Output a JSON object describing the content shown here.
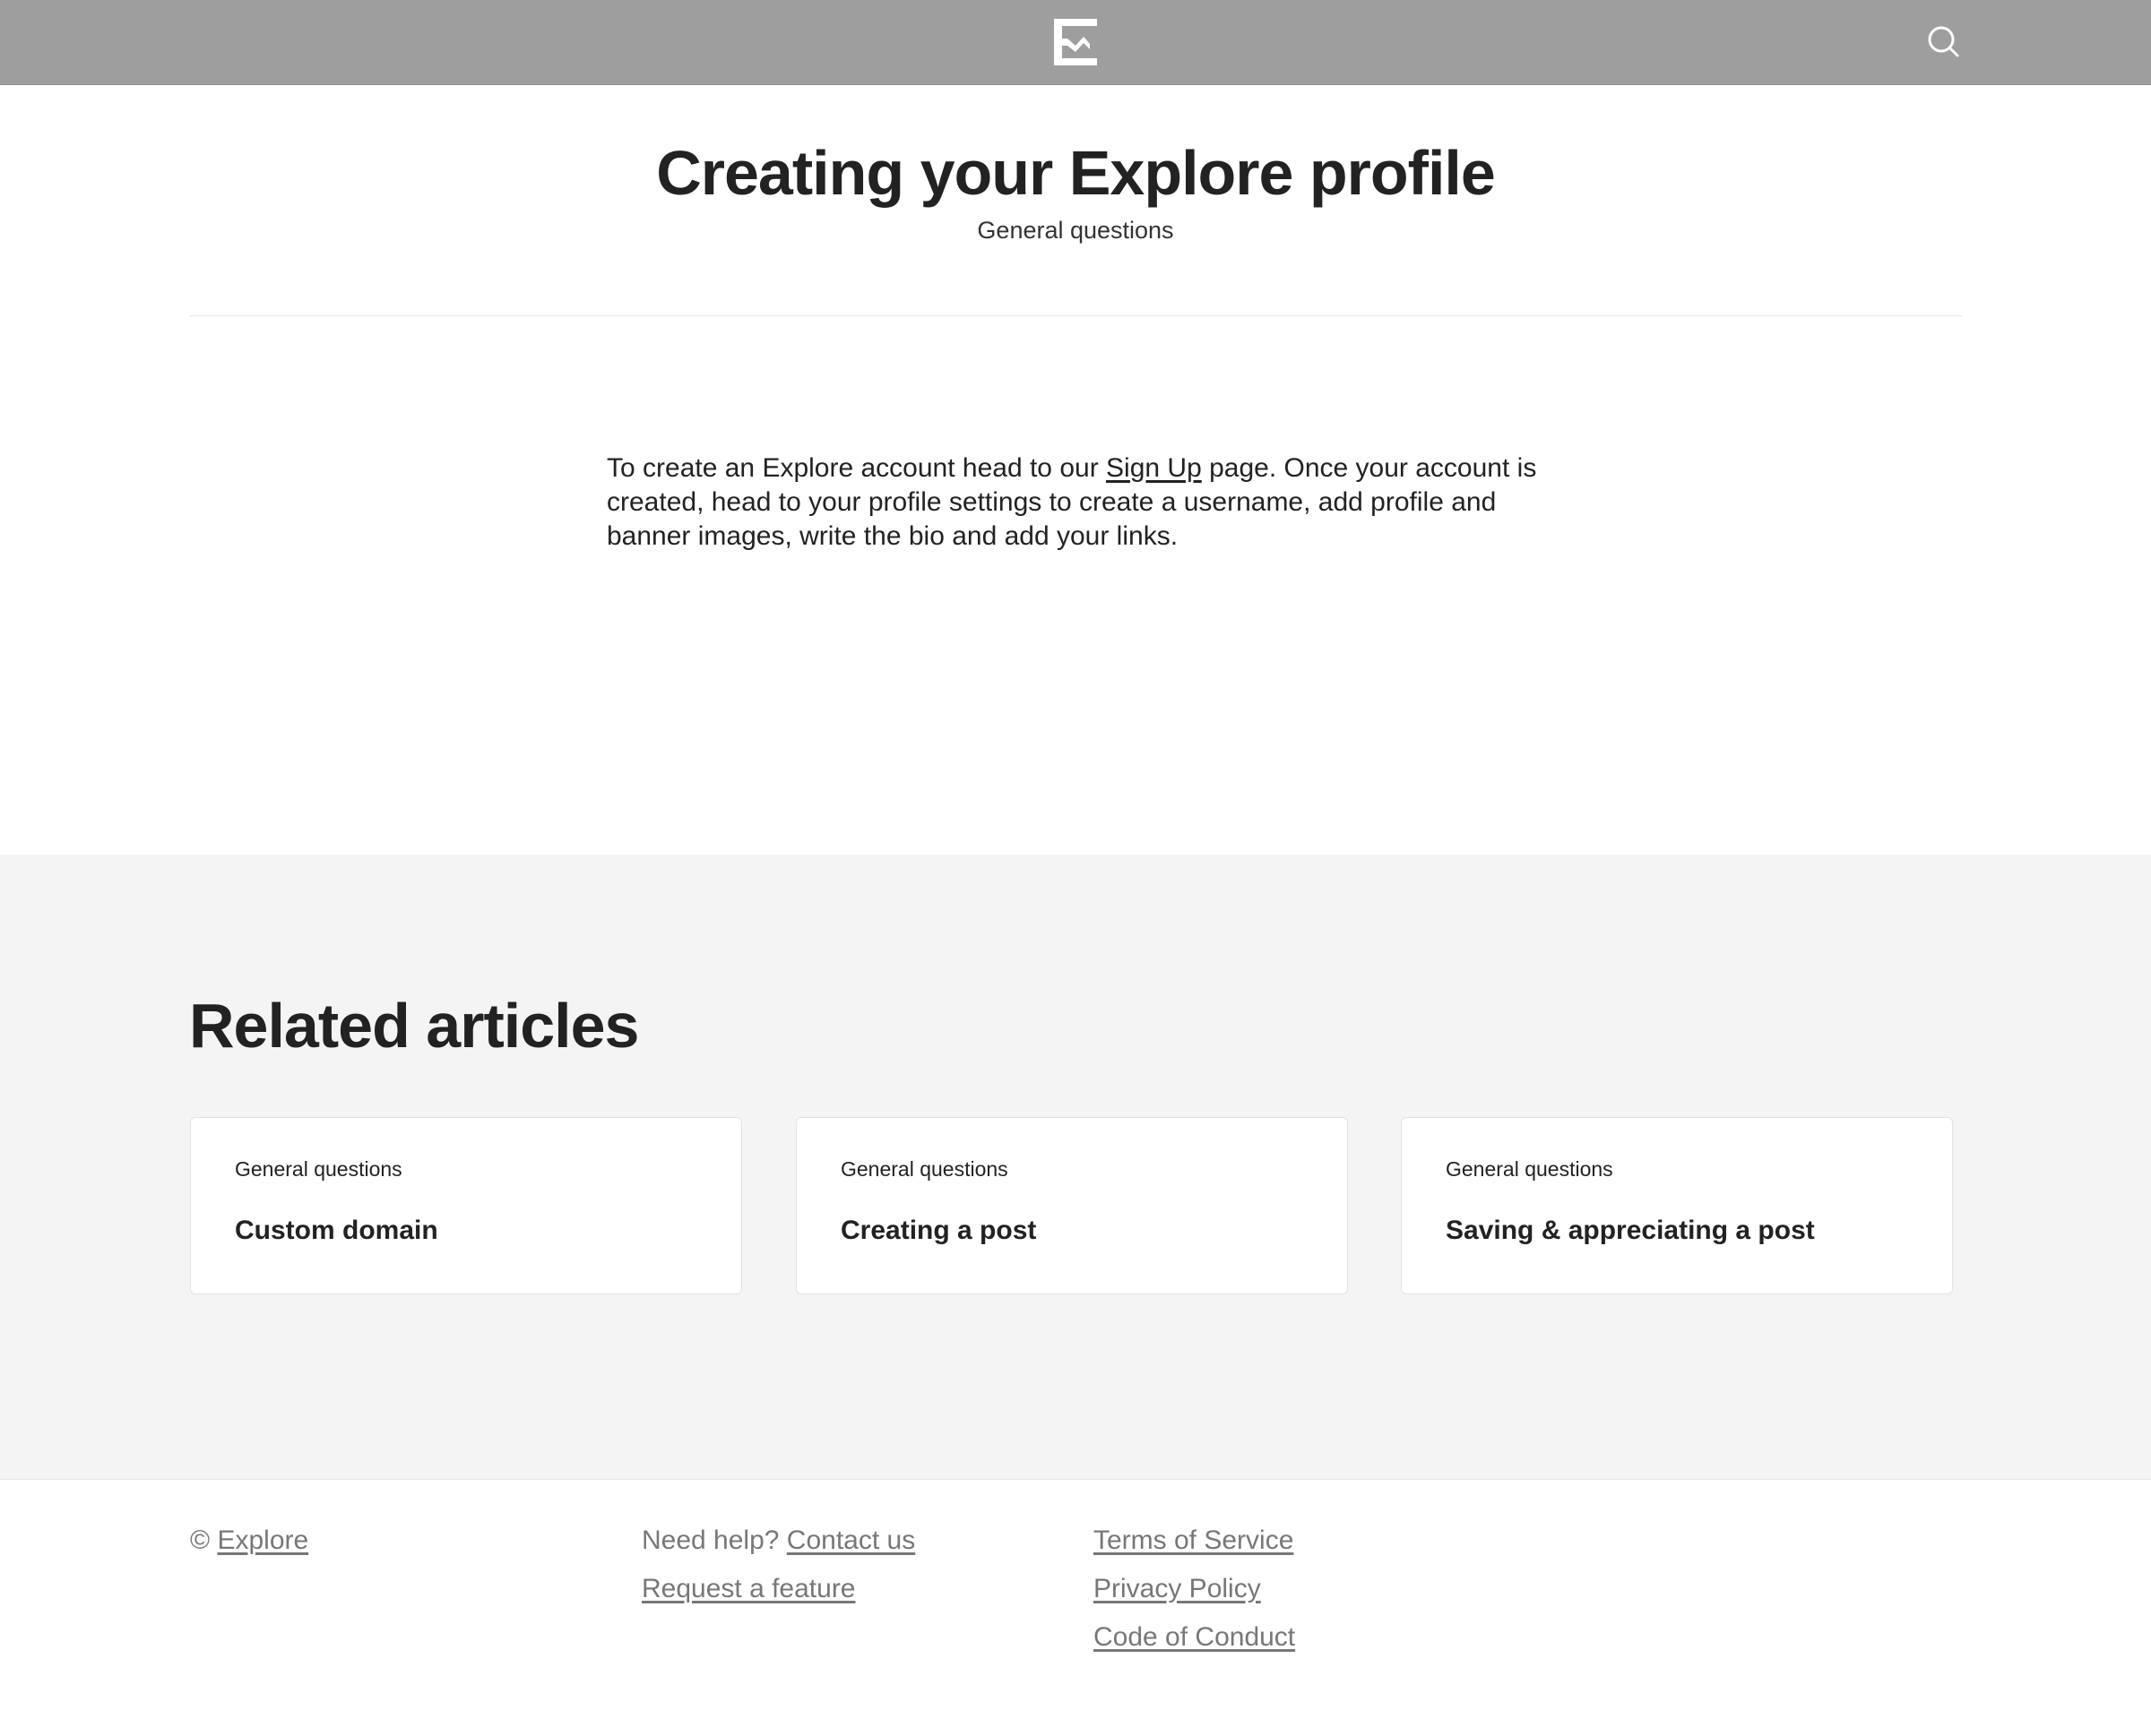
{
  "header": {
    "logo_icon": "explore-logo-icon",
    "search_icon": "search-icon"
  },
  "article": {
    "title": "Creating your Explore profile",
    "category": "General questions",
    "body_before_link": "To create an Explore account head to our ",
    "body_link": "Sign Up",
    "body_after_link": " page. Once your account is created, head to your profile settings to create a username, add profile and banner images, write the bio and add your links."
  },
  "related": {
    "heading": "Related articles",
    "cards": [
      {
        "category": "General questions",
        "title": "Custom domain"
      },
      {
        "category": "General questions",
        "title": "Creating a post"
      },
      {
        "category": "General questions",
        "title": "Saving & appreciating a post"
      }
    ]
  },
  "footer": {
    "copyright_symbol": "© ",
    "brand_link": "Explore",
    "help_prefix": "Need help? ",
    "contact_link": "Contact us",
    "request_link": "Request a feature",
    "terms_link": "Terms of Service",
    "privacy_link": "Privacy Policy",
    "conduct_link": "Code of Conduct"
  },
  "colors": {
    "header_bg": "#9e9e9e",
    "section_bg": "#f4f4f4",
    "text": "#222222",
    "footer_text": "#777777"
  }
}
